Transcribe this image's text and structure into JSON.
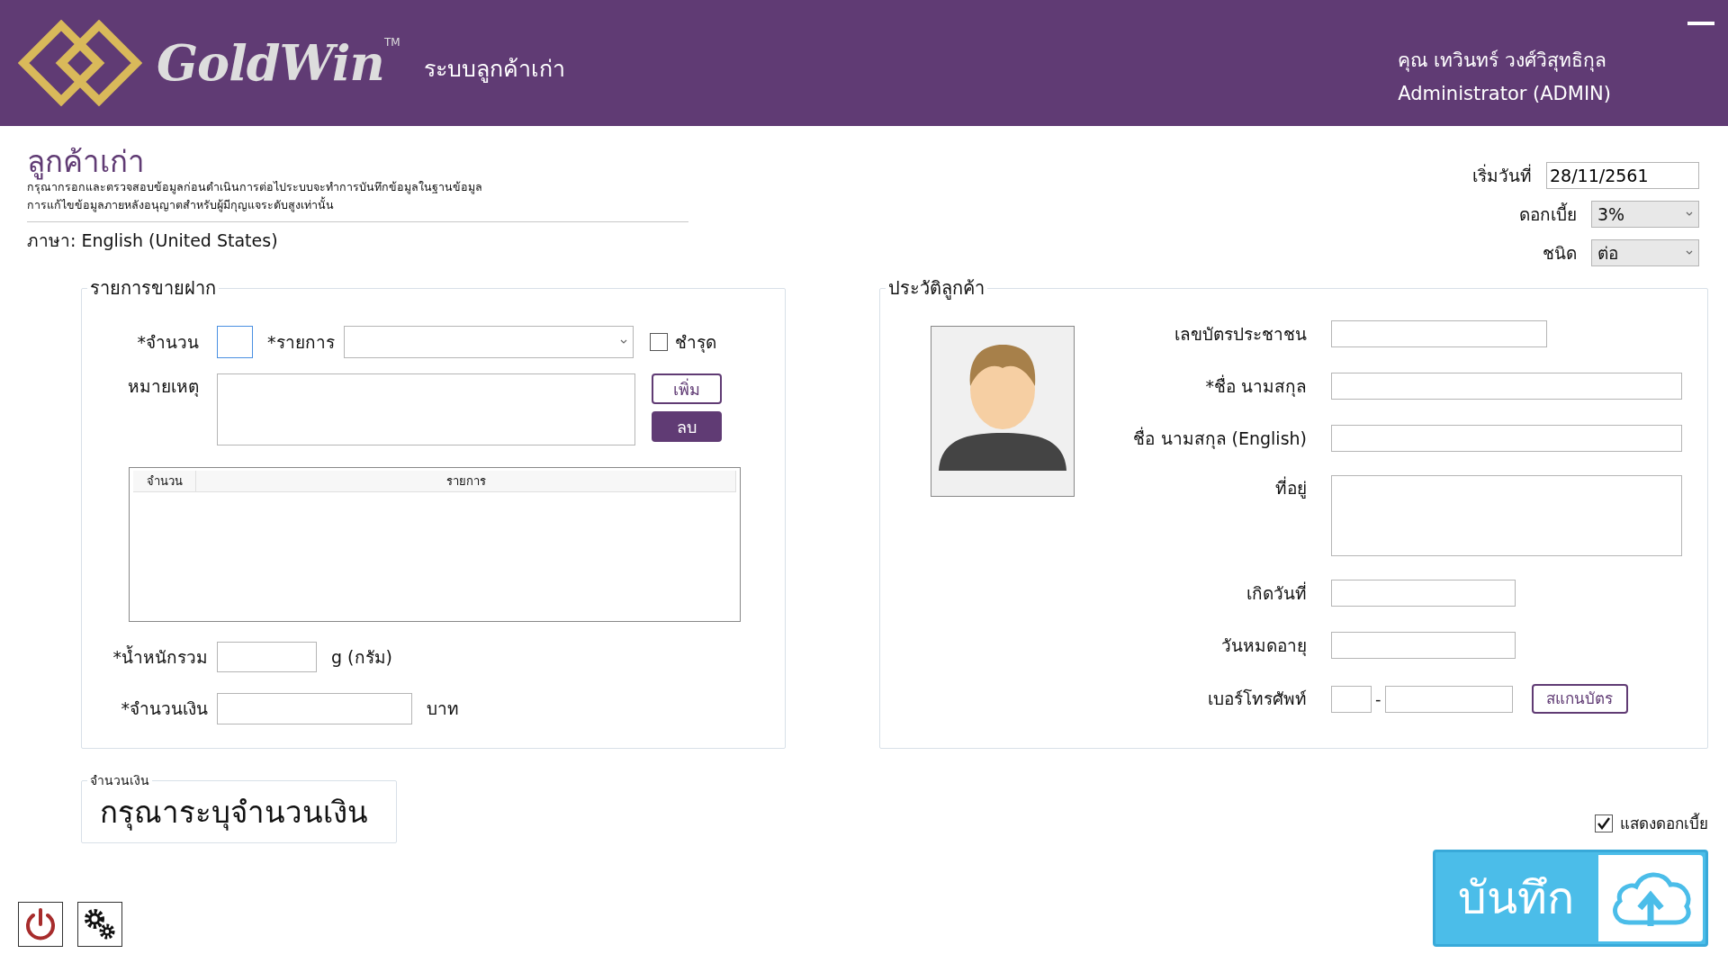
{
  "header": {
    "logo_text": "GoldWin",
    "trademark": "TM",
    "system_name": "ระบบลูกค้าเก่า",
    "user_name": "คุณ เทวินทร์ วงศ์วิสุทธิกุล",
    "user_role": "Administrator (ADMIN)"
  },
  "page": {
    "title": "ลูกค้าเก่า",
    "description": [
      "กรุณากรอกและตรวจสอบข้อมูลก่อนดำเนินการต่อไประบบจะทำการบันทึกข้อมูลในฐานข้อมูล",
      "การแก้ไขข้อมูลภายหลังอนุญาตสำหรับผู้มีกุญแจระดับสูงเท่านั้น"
    ],
    "language": "ภาษา: English (United States)"
  },
  "top_fields": [
    {
      "label": "เริ่มวันที่",
      "value": "28/11/2561",
      "kind": "text"
    },
    {
      "label": "ดอกเบี้ย",
      "value": "3%",
      "kind": "dropdown"
    },
    {
      "label": "ชนิด",
      "value": "ต่อ",
      "kind": "dropdown"
    }
  ],
  "deposit_panel": {
    "legend": "รายการขายฝาก",
    "quantity": {
      "label": "*จำนวน",
      "focused": true
    },
    "item": {
      "label": "*รายการ"
    },
    "damaged": {
      "label": "ชำรุด",
      "checked": false
    },
    "note": {
      "label": "หมายเหตุ"
    },
    "buttons": [
      {
        "label": "เพิ่ม",
        "kind": "outline"
      },
      {
        "label": "ลบ",
        "kind": "filled"
      }
    ],
    "table": {
      "columns": [
        "จำนวน",
        "รายการ"
      ]
    },
    "weight": {
      "label": "*น้ำหนักรวม",
      "unit": "g (กรัม)"
    },
    "amount": {
      "label": "*จำนวนเงิน",
      "unit": "บาท"
    }
  },
  "customer_panel": {
    "legend": "ประวัติลูกค้า",
    "fields": [
      {
        "label": "เลขบัตรประชาชน",
        "kind": "short"
      },
      {
        "label": "*ชื่อ นามสกุล",
        "kind": "long"
      },
      {
        "label": "ชื่อ นามสกุล (English)",
        "kind": "long"
      },
      {
        "label": "ที่อยู่",
        "kind": "multiline"
      },
      {
        "label": "เกิดวันที่",
        "kind": "medium"
      },
      {
        "label": "วันหมดอายุ",
        "kind": "medium"
      },
      {
        "label": "เบอร์โทรศัพท์",
        "kind": "phone",
        "separator": "-"
      }
    ],
    "scan_button": "สแกนบัตร"
  },
  "amount_box": {
    "legend": "จำนวนเงิน",
    "message": "กรุณาระบุจำนวนเงิน"
  },
  "show_interest": {
    "label": "แสดงดอกเบี้ย",
    "checked": true
  },
  "save_button": {
    "label": "บันทึก"
  }
}
